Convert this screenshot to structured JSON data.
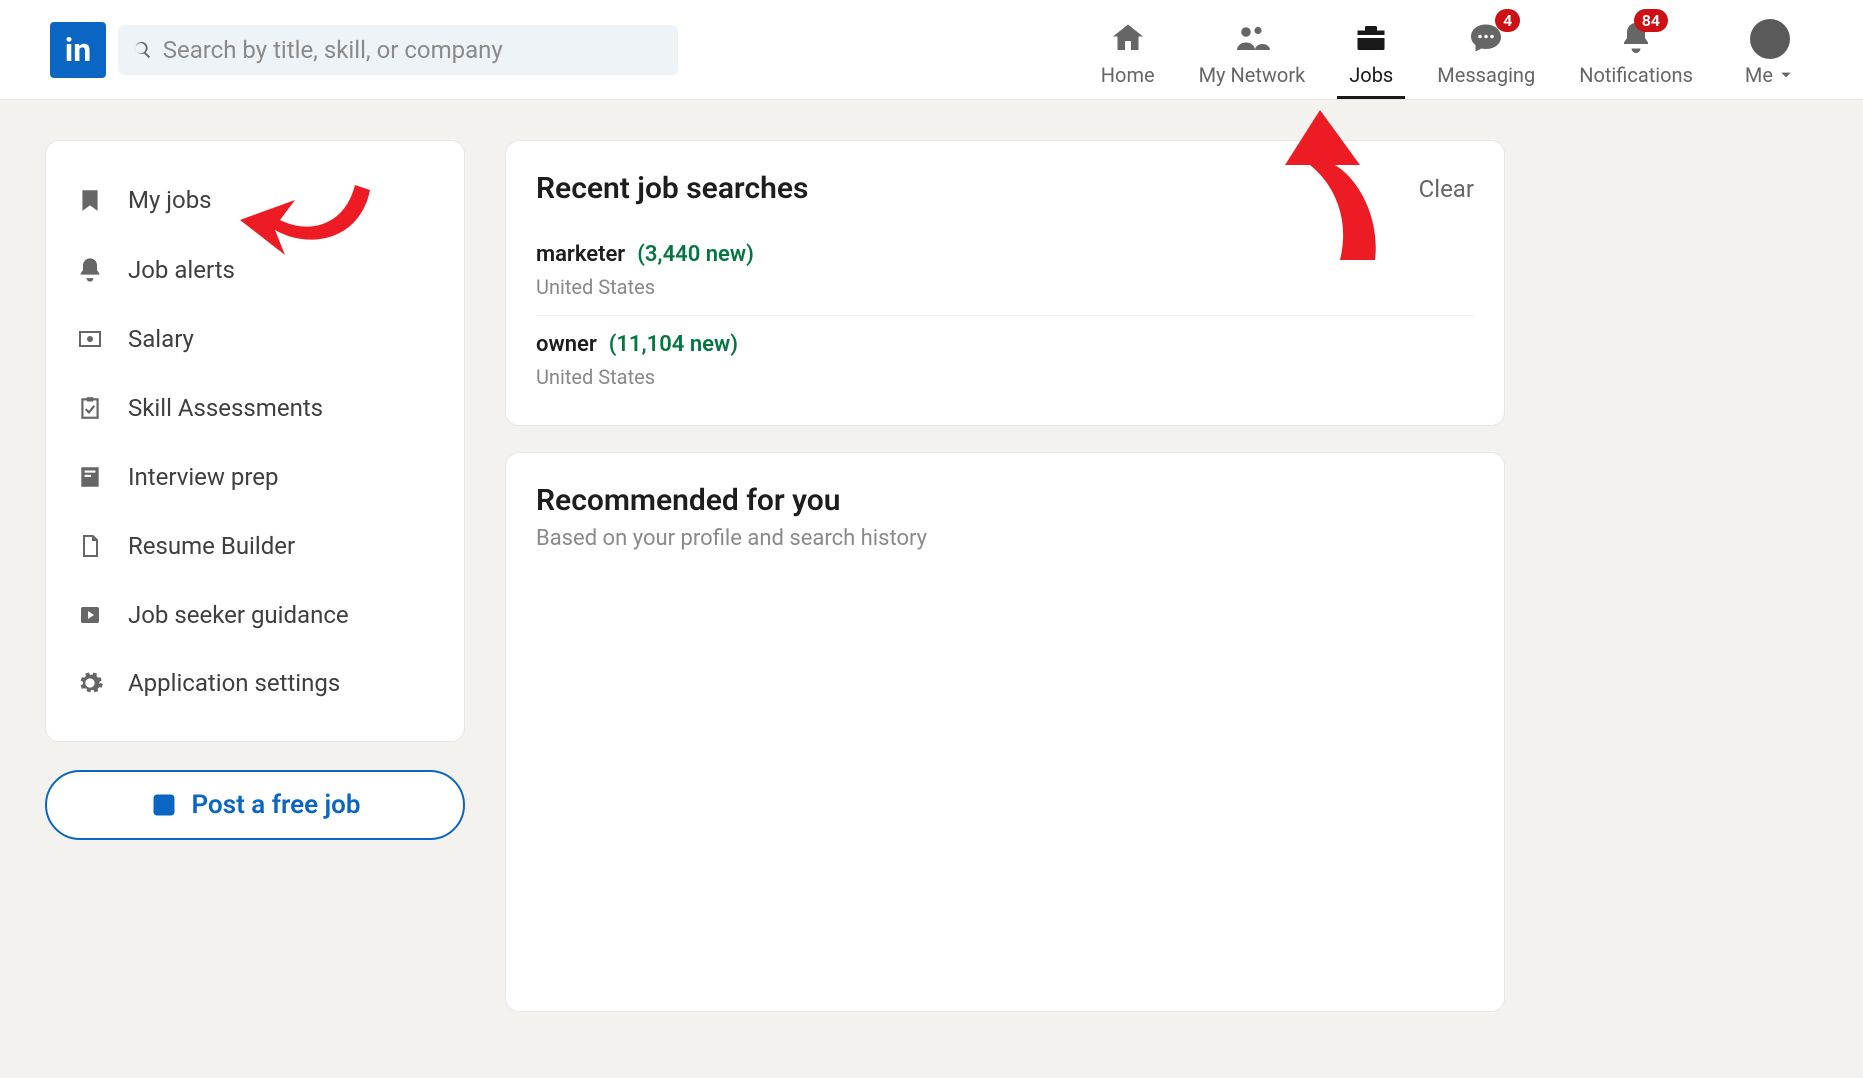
{
  "header": {
    "search_placeholder": "Search by title, skill, or company",
    "nav": {
      "home": "Home",
      "network": "My Network",
      "jobs": "Jobs",
      "messaging": "Messaging",
      "notifications": "Notifications",
      "me": "Me"
    },
    "badges": {
      "messaging": "4",
      "notifications": "84"
    }
  },
  "sidebar": {
    "items": [
      "My jobs",
      "Job alerts",
      "Salary",
      "Skill Assessments",
      "Interview prep",
      "Resume Builder",
      "Job seeker guidance",
      "Application settings"
    ],
    "post_job": "Post a free job"
  },
  "recent": {
    "title": "Recent job searches",
    "clear": "Clear",
    "rows": [
      {
        "term": "marketer",
        "new": "(3,440 new)",
        "location": "United States"
      },
      {
        "term": "owner",
        "new": "(11,104 new)",
        "location": "United States"
      }
    ]
  },
  "recommended": {
    "title": "Recommended for you",
    "subtitle": "Based on your profile and search history"
  }
}
